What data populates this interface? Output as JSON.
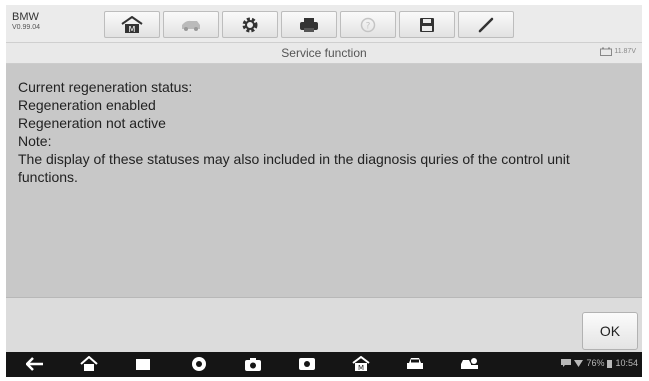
{
  "vehicle": {
    "make": "BMW",
    "version": "V0.99.04"
  },
  "toolbar": {
    "buttons": [
      {
        "icon": "home-icon"
      },
      {
        "icon": "vehicle-swap-icon"
      },
      {
        "icon": "settings-gear-icon"
      },
      {
        "icon": "print-icon"
      },
      {
        "icon": "help-icon"
      },
      {
        "icon": "save-icon"
      },
      {
        "icon": "data-logging-icon"
      }
    ]
  },
  "titlebar": {
    "title": "Service function",
    "battery_voltage": "11.87V"
  },
  "message": {
    "lines": [
      "Current regeneration status:",
      "Regeneration enabled",
      "Regeneration not active",
      "Note:",
      "The display of these statuses may also included in the diagnosis quries of the control unit functions."
    ]
  },
  "bottombar": {
    "ok_label": "OK"
  },
  "statusbar": {
    "battery": "76%",
    "time": "10:54"
  },
  "colors": {
    "toolbar_bg": "#ebebeb",
    "content_bg": "#c8c8c8",
    "navbar_bg": "#151515"
  }
}
